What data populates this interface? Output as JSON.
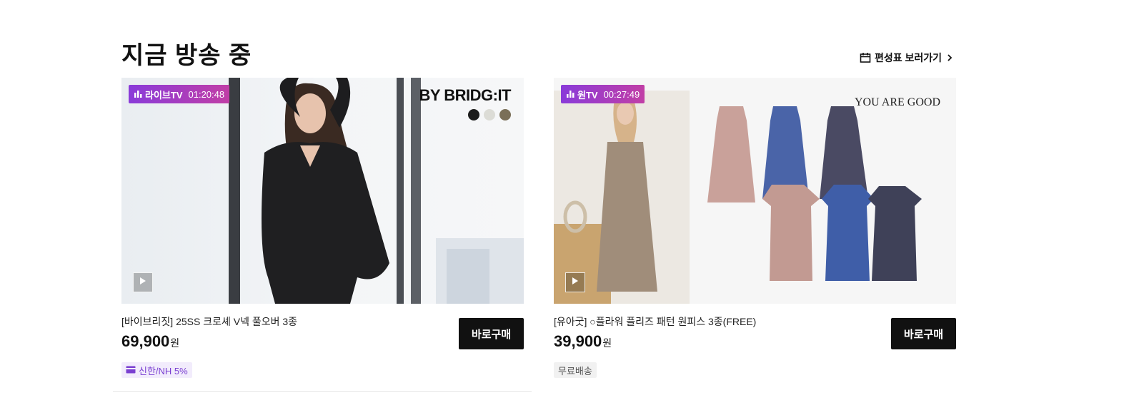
{
  "section": {
    "title": "지금 방송 중",
    "schedule_link": "편성표 보러가기"
  },
  "cards": [
    {
      "badge_channel": "라이브TV",
      "badge_time": "01:20:48",
      "brand_logo": "BY BRIDG:IT",
      "swatch_colors": [
        "#1c1c1c",
        "#dcdcd6",
        "#7a6f58"
      ],
      "product_name": "[바이브리짓] 25SS 크로셰 V넥 풀오버 3종",
      "price": "69,900",
      "currency": "원",
      "buy_label": "바로구매",
      "tag": "신한/NH 5%",
      "tag_icon": "card-icon"
    },
    {
      "badge_channel": "원TV",
      "badge_time": "00:27:49",
      "brand_logo": "YOU ARE GOOD",
      "product_name": "[유아굿] ○플라워 플리즈 패턴 원피스 3종(FREE)",
      "price": "39,900",
      "currency": "원",
      "buy_label": "바로구매",
      "tag": "무료배송"
    }
  ],
  "colors": {
    "badge_gradient_start": "#8a3bd9",
    "badge_gradient_end": "#c13ea6",
    "buy_button": "#111111",
    "card_benefit_bg": "#f2ecfc",
    "card_benefit_text": "#7a3fd1"
  }
}
